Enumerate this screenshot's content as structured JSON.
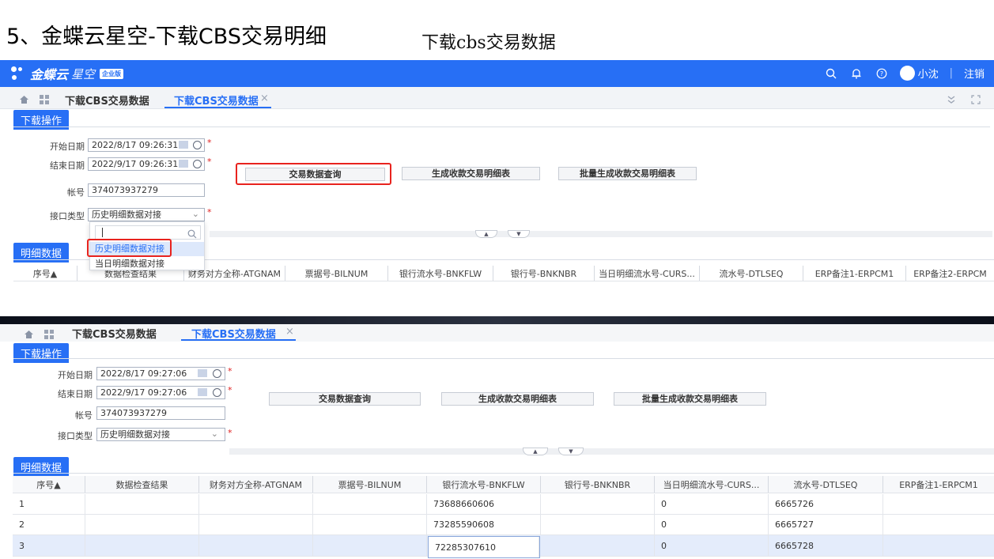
{
  "slide": {
    "title": "5、金蝶云星空-下载CBS交易明细",
    "subtitle": "下载cbs交易数据"
  },
  "topbar": {
    "brand": "金蝶云",
    "brand_sub": "星空",
    "edition_badge": "企业版",
    "user_name": "小沈",
    "logout_label": "注销",
    "background_color": "#276ff5"
  },
  "panel1": {
    "tabs": {
      "static_label": "下载CBS交易数据",
      "active_label": "下载CBS交易数据",
      "close_glyph": "×"
    },
    "section_label": "下载操作",
    "form": {
      "start_date_label": "开始日期",
      "start_date_value": "2022/8/17 09:26:31",
      "end_date_label": "结束日期",
      "end_date_value": "2022/9/17 09:26:31",
      "account_label": "帐号",
      "account_value": "374073937279",
      "interface_label": "接口类型",
      "interface_value": "历史明细数据对接"
    },
    "buttons": {
      "query": "交易数据查询",
      "generate": "生成收款交易明细表",
      "batch_generate": "批量生成收款交易明细表"
    },
    "dropdown_options": [
      "历史明细数据对接",
      "当日明细数据对接"
    ],
    "grid_section_label": "明细数据",
    "grid_columns": [
      "序号▲",
      "数据检查结果",
      "财务对方全称-ATGNAM",
      "票据号-BILNUM",
      "银行流水号-BNKFLW",
      "银行号-BNKNBR",
      "当日明细流水号-CURS...",
      "流水号-DTLSEQ",
      "ERP备注1-ERPCM1",
      "ERP备注2-ERPCM"
    ]
  },
  "panel2": {
    "tabs": {
      "static_label": "下载CBS交易数据",
      "active_label": "下载CBS交易数据",
      "close_glyph": "×"
    },
    "section_label": "下载操作",
    "form": {
      "start_date_label": "开始日期",
      "start_date_value": "2022/8/17 09:27:06",
      "end_date_label": "结束日期",
      "end_date_value": "2022/9/17 09:27:06",
      "account_label": "帐号",
      "account_value": "374073937279",
      "interface_label": "接口类型",
      "interface_value": "历史明细数据对接"
    },
    "buttons": {
      "query": "交易数据查询",
      "generate": "生成收款交易明细表",
      "batch_generate": "批量生成收款交易明细表"
    },
    "grid_section_label": "明细数据",
    "grid_columns": [
      "序号▲",
      "数据检查结果",
      "财务对方全称-ATGNAM",
      "票据号-BILNUM",
      "银行流水号-BNKFLW",
      "银行号-BNKNBR",
      "当日明细流水号-CURS...",
      "流水号-DTLSEQ",
      "ERP备注1-ERPCM1"
    ],
    "rows": [
      {
        "seq": "1",
        "bnkflw": "73688660606",
        "curs": "0",
        "dtlseq": "6665726"
      },
      {
        "seq": "2",
        "bnkflw": "73285590608",
        "curs": "0",
        "dtlseq": "6665727"
      },
      {
        "seq": "3",
        "bnkflw": "72285307610",
        "curs": "0",
        "dtlseq": "6665728"
      }
    ]
  }
}
